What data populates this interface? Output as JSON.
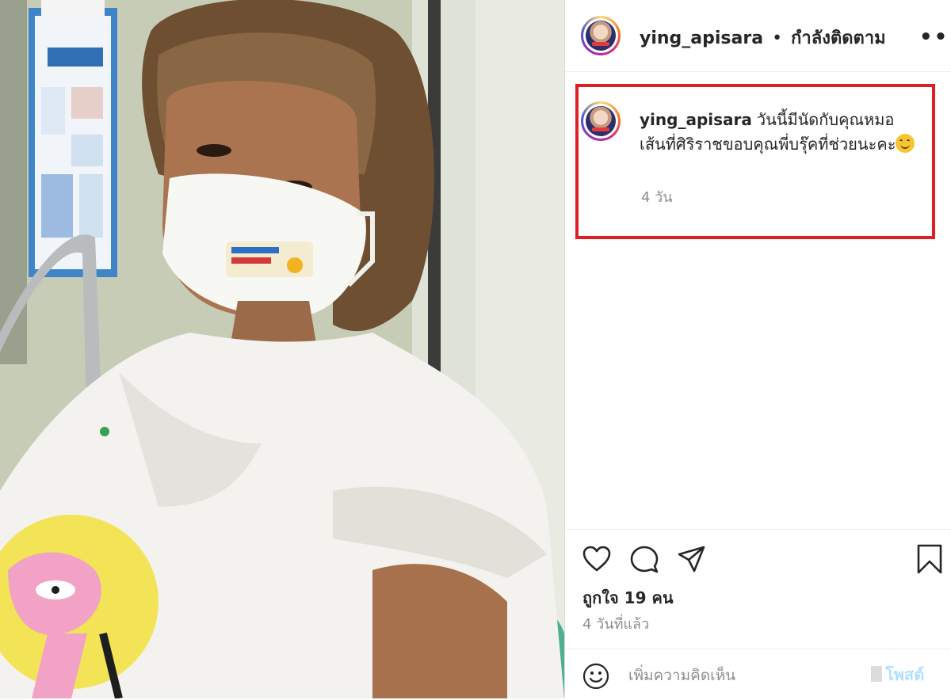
{
  "post": {
    "username": "ying_apisara",
    "separator": "•",
    "follow_status": "กำลังติดตาม",
    "more_icon": "more-horizontal-icon"
  },
  "caption": {
    "username": "ying_apisara",
    "text": "วันนี้มีนัดกับคุณหมอเส้นที่ศิริราชขอบคุณพี่บรุ๊คที่ช่วยนะคะ",
    "emoji": "smiling-face-emoji",
    "time": "4 วัน",
    "highlight_color": "#e01e24"
  },
  "actions": {
    "icons": [
      "heart-icon",
      "comment-icon",
      "share-icon",
      "bookmark-icon"
    ],
    "likes": "ถูกใจ 19 คน",
    "time_ago": "4 วันที่แล้ว"
  },
  "comment_bar": {
    "placeholder": "เพิ่มความคิดเห็น",
    "post_label": "โพสต์",
    "emoji_icon": "smiley-icon"
  }
}
